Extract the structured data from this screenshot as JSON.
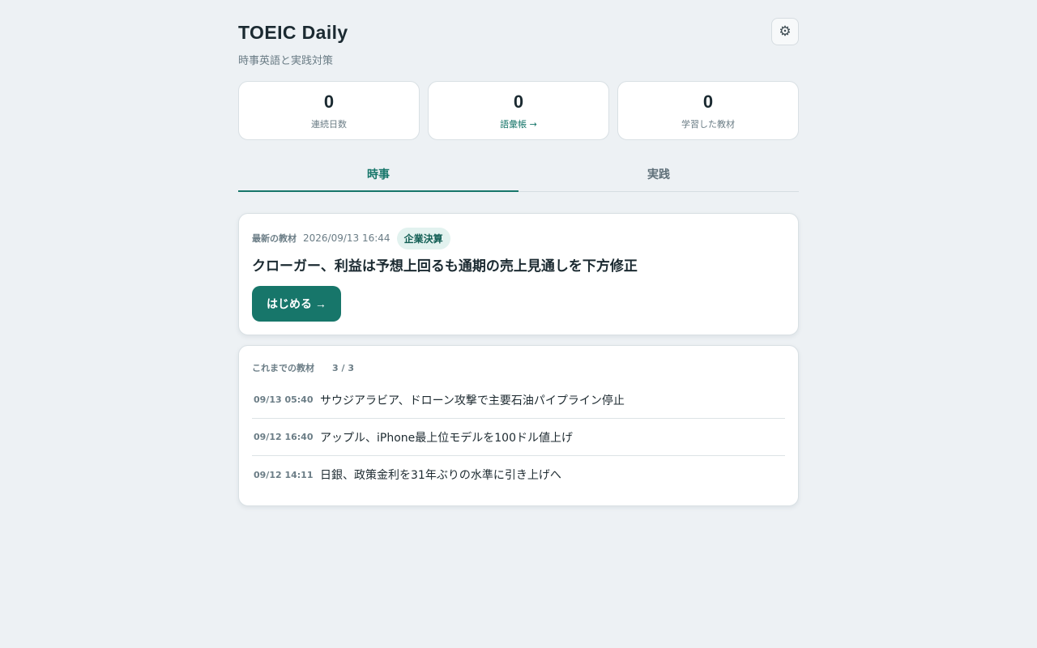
{
  "header": {
    "title": "TOEIC Daily",
    "subtitle": "時事英語と実践対策",
    "settings_icon": "⚙"
  },
  "stats": [
    {
      "value": "0",
      "label": "連続日数"
    },
    {
      "value": "0",
      "label": "語彙帳 →"
    },
    {
      "value": "0",
      "label": "学習した教材"
    }
  ],
  "tabs": [
    {
      "label": "時事",
      "active": true
    },
    {
      "label": "実践",
      "active": false
    }
  ],
  "latest": {
    "label": "最新の教材",
    "date": "2026/09/13 16:44",
    "category": "企業決算",
    "title": "クローガー、利益は予想上回るも通期の売上見通しを下方修正",
    "start_label": "はじめる →"
  },
  "history": {
    "label": "これまでの教材",
    "count": "3 / 3",
    "items": [
      {
        "date": "09/13 05:40",
        "title": "サウジアラビア、ドローン攻撃で主要石油パイプライン停止"
      },
      {
        "date": "09/12 16:40",
        "title": "アップル、iPhone最上位モデルを100ドル値上げ"
      },
      {
        "date": "09/12 14:11",
        "title": "日銀、政策金利を31年ぶりの水準に引き上げへ"
      }
    ]
  },
  "colors": {
    "accent": "#17766a",
    "background": "#edf1f4",
    "badge_bg": "#e2f2ef"
  }
}
